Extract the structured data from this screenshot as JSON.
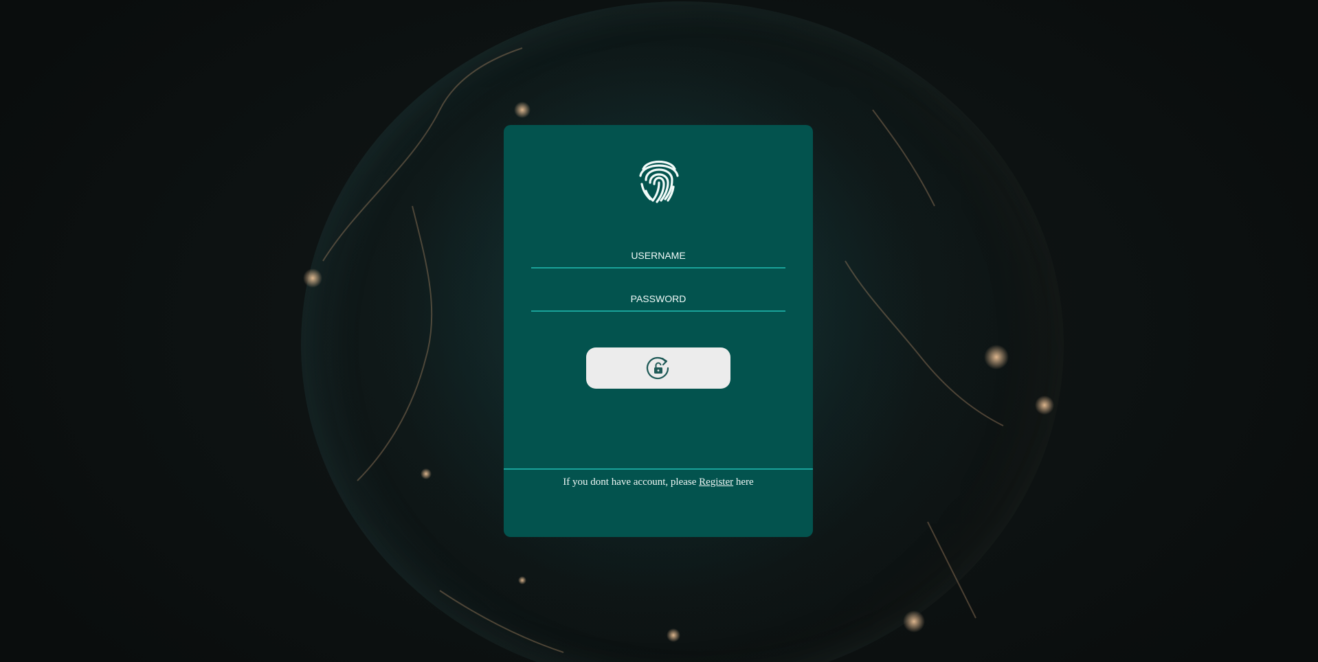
{
  "login": {
    "username_placeholder": "USERNAME",
    "password_placeholder": "PASSWORD",
    "footer_prefix": "If you dont have account, please ",
    "register_link": "Register",
    "footer_suffix": " here"
  },
  "icons": {
    "logo": "fingerprint-icon",
    "submit": "rotate-unlock-icon"
  },
  "colors": {
    "card": "#03534e",
    "accent_line": "#1aa39a",
    "button": "#ececec",
    "text": "#f2fbf9",
    "background": "#0b0f0f"
  }
}
